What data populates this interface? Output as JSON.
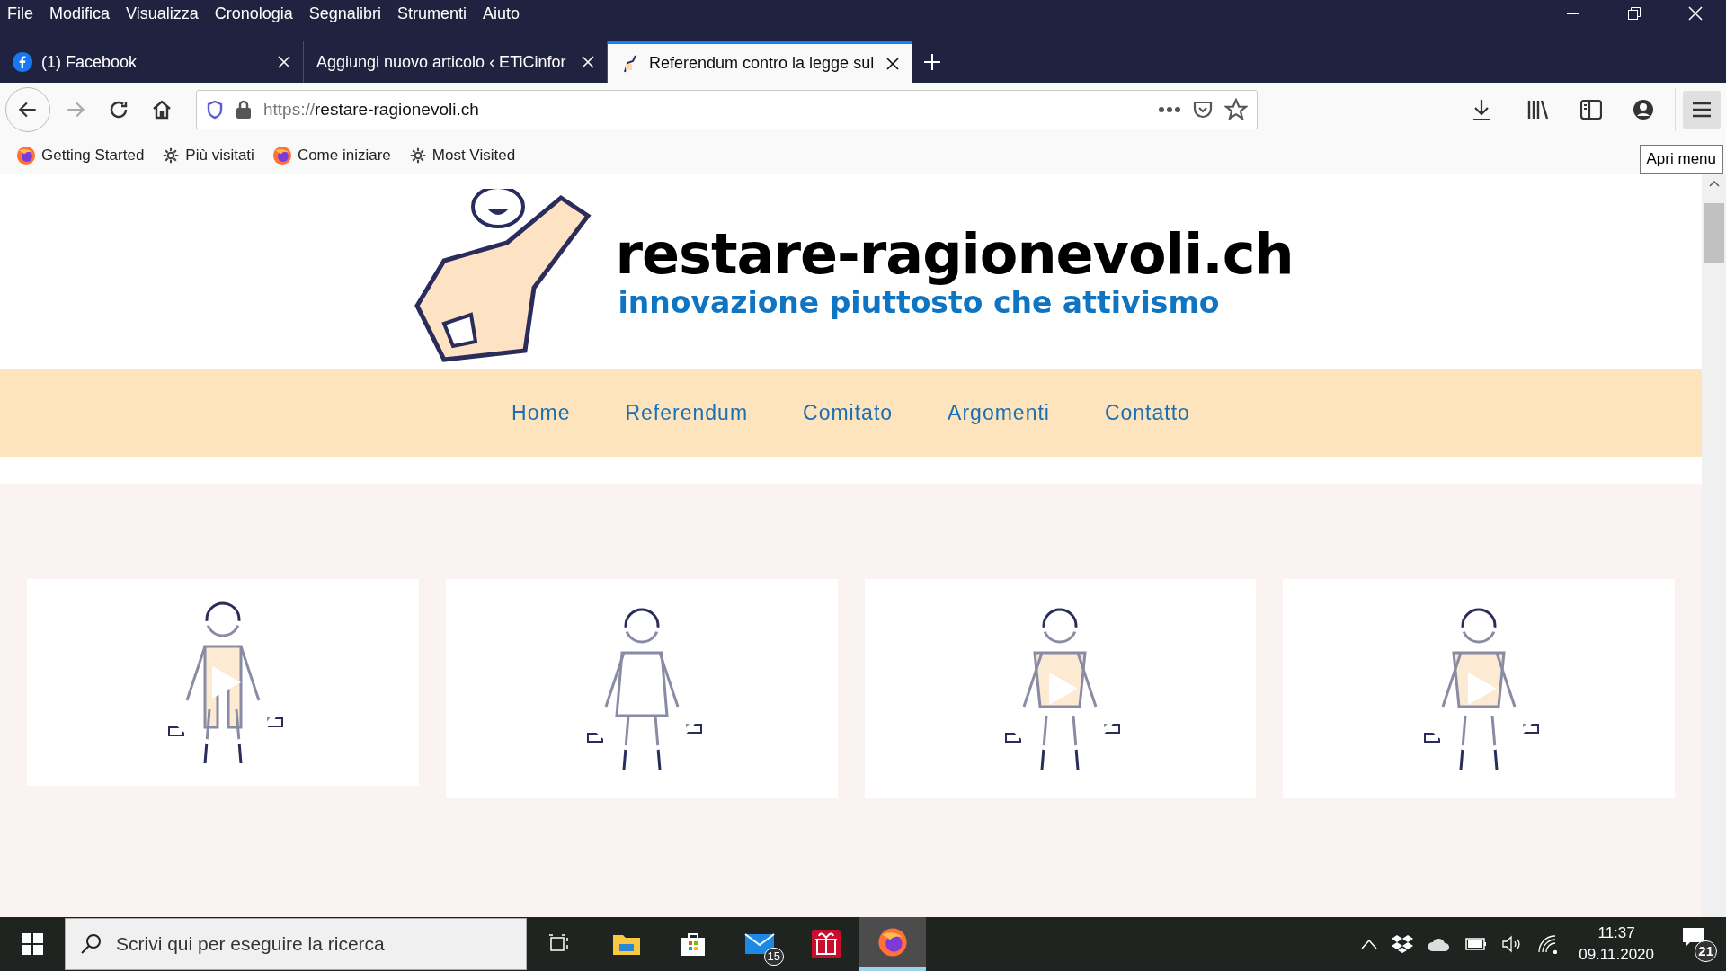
{
  "menu_bar": [
    "File",
    "Modifica",
    "Visualizza",
    "Cronologia",
    "Segnalibri",
    "Strumenti",
    "Aiuto"
  ],
  "tabs": [
    {
      "label": "(1) Facebook",
      "kind": "facebook",
      "selected": false
    },
    {
      "label": "Aggiungi nuovo articolo ‹ ETiCinfor",
      "kind": "plain",
      "selected": false
    },
    {
      "label": "Referendum contro la legge sul",
      "kind": "site",
      "selected": true
    }
  ],
  "address_bar": {
    "scheme": "https://",
    "host": "restare-ragionevoli.ch"
  },
  "bookmarks": [
    {
      "label": "Getting Started",
      "kind": "firefox"
    },
    {
      "label": "Più visitati",
      "kind": "gear"
    },
    {
      "label": "Come iniziare",
      "kind": "firefox"
    },
    {
      "label": "Most Visited",
      "kind": "gear"
    }
  ],
  "tooltip": "Apri menu",
  "site": {
    "title": "restare-ragionevoli.ch",
    "tagline": "innovazione piuttosto che attivismo",
    "nav": [
      "Home",
      "Referendum",
      "Comitato",
      "Argomenti",
      "Contatto"
    ],
    "video_cards": [
      {
        "kind": "overalls"
      },
      {
        "kind": "apron"
      },
      {
        "kind": "shirt"
      },
      {
        "kind": "shirt"
      }
    ]
  },
  "taskbar": {
    "search_placeholder": "Scrivi qui per eseguire la ricerca",
    "apps": [
      {
        "kind": "taskview",
        "selected": false
      },
      {
        "kind": "explorer",
        "selected": false
      },
      {
        "kind": "store",
        "selected": false
      },
      {
        "kind": "mail",
        "badge": "15",
        "selected": false
      },
      {
        "kind": "gift",
        "selected": false
      },
      {
        "kind": "firefox",
        "selected": true
      }
    ],
    "time": "11:37",
    "date": "09.11.2020",
    "notifications": "21"
  }
}
